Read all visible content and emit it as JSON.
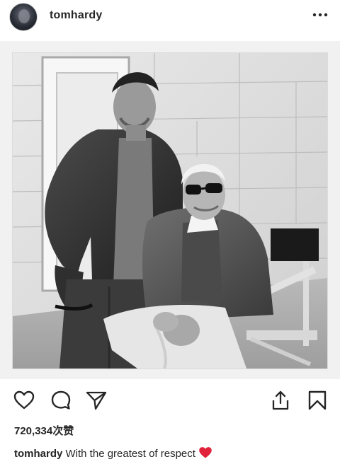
{
  "post": {
    "username": "tomhardy",
    "photo_alt": "",
    "likes": "720,334次赞",
    "caption_user": "tomhardy",
    "caption_text": " With the greatest of respect "
  },
  "icons": {
    "more": "more-horizontal-icon",
    "like": "heart-outline-icon",
    "comment": "comment-bubble-icon",
    "share": "paper-plane-icon",
    "upload": "share-upload-icon",
    "save": "bookmark-icon",
    "emoji": "red-heart-emoji"
  },
  "colors": {
    "text": "#262626",
    "heart_emoji": "#e0223a"
  }
}
